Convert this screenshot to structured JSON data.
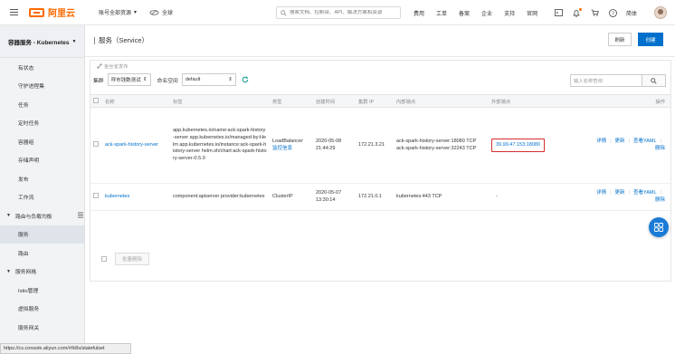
{
  "topbar": {
    "logo_text": "阿里云",
    "account_label": "账号全部资源",
    "region_label": "全球",
    "search_placeholder": "搜索文档、控制台、API、解决方案和资源",
    "links": [
      "费用",
      "工单",
      "备案",
      "企业",
      "支持",
      "官网"
    ],
    "lang": "简体",
    "brand_color": "#ff6a00"
  },
  "sidebar": {
    "title": "容器服务 - Kubernetes",
    "items": [
      {
        "label": "有状态",
        "type": "item"
      },
      {
        "label": "守护进程集",
        "type": "item"
      },
      {
        "label": "任务",
        "type": "item"
      },
      {
        "label": "定时任务",
        "type": "item"
      },
      {
        "label": "容器组",
        "type": "item"
      },
      {
        "label": "存储声明",
        "type": "item"
      },
      {
        "label": "发布",
        "type": "item"
      },
      {
        "label": "工作流",
        "type": "item"
      },
      {
        "label": "路由与负载均衡",
        "type": "group"
      },
      {
        "label": "服务",
        "type": "item",
        "active": true
      },
      {
        "label": "路由",
        "type": "item"
      },
      {
        "label": "服务网格",
        "type": "group"
      },
      {
        "label": "Istio管理",
        "type": "item"
      },
      {
        "label": "虚拟服务",
        "type": "item"
      },
      {
        "label": "服务网关",
        "type": "item"
      }
    ]
  },
  "main": {
    "title": "服务（Service）",
    "refresh_label": "刷新",
    "create_label": "创建",
    "link_sub": "金丝雀发布",
    "cluster_label": "集群",
    "cluster_value": "呼市钱数测试",
    "namespace_label": "命名空间",
    "namespace_value": "default",
    "name_search_placeholder": "输入名称查询",
    "columns": [
      "名称",
      "标签",
      "类型",
      "创建时间",
      "集群 IP",
      "内部端点",
      "外部端点",
      "操作"
    ],
    "rows": [
      {
        "name": "ack-spark-history-server",
        "labels": "app.kubernetes.io/name:ack-spark-history-server app.kubernetes.io/managed-by:Helm app.kubernetes.io/instance:ack-spark-history-server helm.sh/chart:ack-spark-history-server-0.5.0",
        "type": "LoadBalancer",
        "type_link": "监控信息",
        "created": "2020-05-08 21:44:29",
        "cluster_ip": "172.21.3.21",
        "internal_1": "ack-spark-history-server:18080 TCP",
        "internal_2": "ack-spark-history-server:32243 TCP",
        "external": "39.99.47.153:18080",
        "op_detail": "详情",
        "op_update": "更新",
        "op_yaml": "查看YAML",
        "op_delete": "删除"
      },
      {
        "name": "kubernetes",
        "labels": "component:apiserver provider:kubernetes",
        "type": "ClusterIP",
        "created": "2020-05-07 13:30:14",
        "cluster_ip": "172.21.0.1",
        "internal_1": "kubernetes:443 TCP",
        "external": "-",
        "op_detail": "详情",
        "op_update": "更新",
        "op_yaml": "查看YAML",
        "op_delete": "删除"
      }
    ],
    "bulk_delete_label": "批量删除"
  },
  "statusbar": {
    "url": "https://cs.console.aliyun.com/#/k8s/statefulset"
  }
}
